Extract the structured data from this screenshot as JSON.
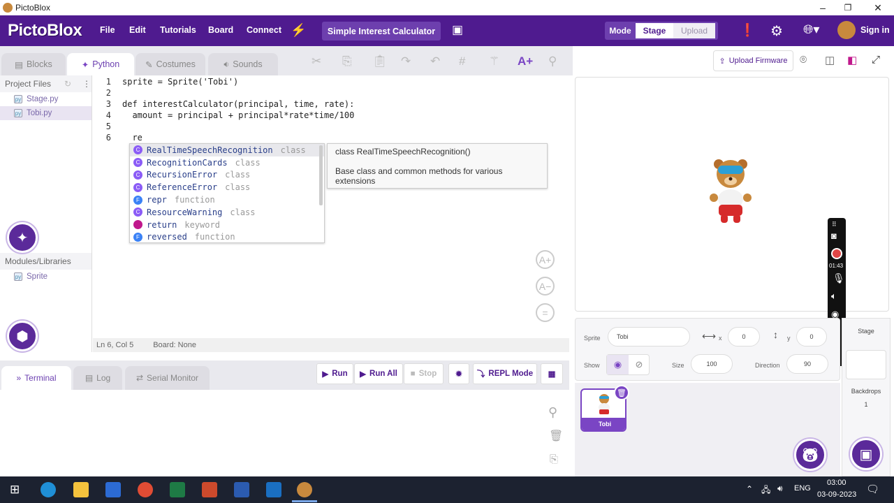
{
  "window": {
    "title": "PictoBlox",
    "minimize": "–",
    "maximize": "❐",
    "close": "✕"
  },
  "menubar": {
    "logo": "PictoBlox",
    "items": [
      "File",
      "Edit",
      "Tutorials",
      "Board",
      "Connect"
    ],
    "project_name": "Simple Interest Calculator",
    "mode_label": "Mode",
    "mode_stage": "Stage",
    "mode_upload": "Upload",
    "signin": "Sign in"
  },
  "editor_tabs": [
    "Blocks",
    "Python",
    "Costumes",
    "Sounds"
  ],
  "upload_firmware": "Upload Firmware",
  "sidebar": {
    "project_files": "Project Files",
    "files": [
      "Stage.py",
      "Tobi.py"
    ],
    "modules_header": "Modules/Libraries",
    "modules": [
      "Sprite"
    ]
  },
  "code": {
    "line_numbers": [
      "1",
      "2",
      "3",
      "4",
      "5",
      "6"
    ],
    "lines": [
      "sprite = Sprite('Tobi')",
      "",
      "def interestCalculator(principal, time, rate):",
      "  amount = principal + principal*rate*time/100",
      "",
      "  re"
    ]
  },
  "autocomplete": {
    "items": [
      {
        "badge": "C",
        "name": "RealTimeSpeechRecognition",
        "kind": "class",
        "color": "#8b5cf6"
      },
      {
        "badge": "C",
        "name": "RecognitionCards",
        "kind": "class",
        "color": "#8b5cf6"
      },
      {
        "badge": "C",
        "name": "RecursionError",
        "kind": "class",
        "color": "#8b5cf6"
      },
      {
        "badge": "C",
        "name": "ReferenceError",
        "kind": "class",
        "color": "#8b5cf6"
      },
      {
        "badge": "F",
        "name": "repr",
        "kind": "function",
        "color": "#3b82f6"
      },
      {
        "badge": "C",
        "name": "ResourceWarning",
        "kind": "class",
        "color": "#8b5cf6"
      },
      {
        "badge": "",
        "name": "return",
        "kind": "keyword",
        "color": "#c0188c"
      },
      {
        "badge": "F",
        "name": "reversed",
        "kind": "function",
        "color": "#3b82f6"
      }
    ],
    "doc_title": "class RealTimeSpeechRecognition()",
    "doc_body": "Base class and common methods for various extensions"
  },
  "statusbar": {
    "position": "Ln 6, Col 5",
    "board": "Board: None"
  },
  "bottom_tabs": [
    "Terminal",
    "Log",
    "Serial Monitor"
  ],
  "run_buttons": {
    "run": "Run",
    "run_all": "Run All",
    "stop": "Stop",
    "repl": "REPL Mode"
  },
  "sprite_props": {
    "sprite_label": "Sprite",
    "sprite_name": "Tobi",
    "x_label": "x",
    "x_value": "0",
    "y_label": "y",
    "y_value": "0",
    "show_label": "Show",
    "size_label": "Size",
    "size_value": "100",
    "direction_label": "Direction",
    "direction_value": "90"
  },
  "sprite_tile": {
    "name": "Tobi"
  },
  "stage_side": {
    "stage": "Stage",
    "backdrops": "Backdrops",
    "count": "1"
  },
  "recorder": {
    "time": "01:43"
  },
  "taskbar": {
    "lang": "ENG",
    "time": "03:00",
    "date": "03-09-2023"
  },
  "colors": {
    "brand_purple": "#4f1b8f",
    "accent": "#6b3fb0"
  }
}
